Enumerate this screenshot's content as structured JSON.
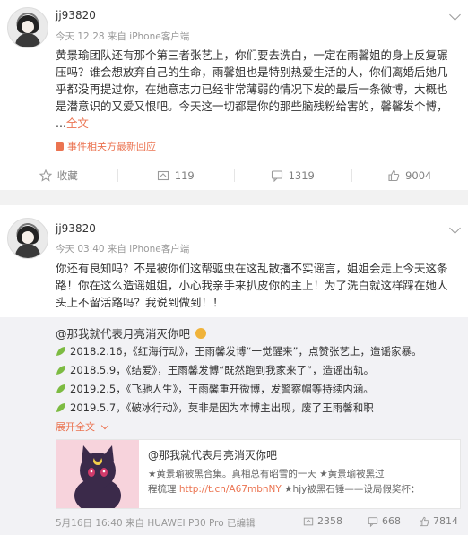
{
  "posts": [
    {
      "username": "jj93820",
      "meta": "今天 12:28 来自 iPhone客户端",
      "lines": [
        "黄景瑜团队还有那个第三者张艺上，你们要去洗白，一定在雨馨姐的身上反复碾",
        "压吗？谁会想放弃自己的生命，雨馨姐也是特别热爱生活的人，你们离婚后她几",
        "乎都没再提过你，在她意志力已经非常薄弱的情况下发的最后一条微博，大概也",
        "是潜意识的又爱又恨吧。今天这一切都是你的那些脑残粉给害的，馨馨发个博，",
        "..."
      ],
      "more": "全文",
      "event": "事件相关方最新回应",
      "actions": {
        "favorite": "收藏",
        "repost": "119",
        "comment": "1319",
        "like": "9004"
      }
    },
    {
      "username": "jj93820",
      "meta": "今天 03:40 来自 iPhone客户端",
      "lines": [
        "你还有良知吗？不是被你们这帮驱虫在这乱散播不实谣言，姐姐会走上今天这条",
        "路！你在这么造谣姐姐，小心我亲手来扒皮你的主上！为了洗白就这样踩在她人",
        "头上不留活路吗？我说到做到！！"
      ],
      "repost": {
        "author": "@那我就代表月亮消灭你吧",
        "items": [
          {
            "prefix": "2018.2.16，《红海行动》，王雨馨发博“一觉醒来”，点赞张艺上，造谣家暴。"
          },
          {
            "prefix": "2018.5.9，《结爱》，王雨馨发博“既然跑到我家来了”，造谣出轨。"
          },
          {
            "prefix": "2019.2.5，《飞驰人生》，王雨馨重开微博，发警察帽等持续内涵。"
          },
          {
            "prefix": "2019.5.7，《破冰行动》，莫非是因为本博主出现，废了王雨馨和职"
          }
        ],
        "more": "展开全文",
        "quote": {
          "title": "@那我就代表月亮消灭你吧",
          "desc_line1": "★黄景瑜被黑合集。真相总有昭雪的一天 ★黄景瑜被黑过",
          "desc_line2_pre": "程梳理 ",
          "desc_link": "http://t.cn/A67mbnNY",
          "desc_line2_post": " ★hjy被黑石锤——设局假奖杯："
        },
        "bottom": {
          "meta": "5月16日 16:40 来自 HUAWEI P30 Pro  已编辑",
          "repost": "2358",
          "comment": "668",
          "like": "7814"
        }
      }
    }
  ],
  "colors": {
    "accent": "#eb7350",
    "background": "#f2f2f2",
    "repost_bg": "#f2f2f5"
  }
}
